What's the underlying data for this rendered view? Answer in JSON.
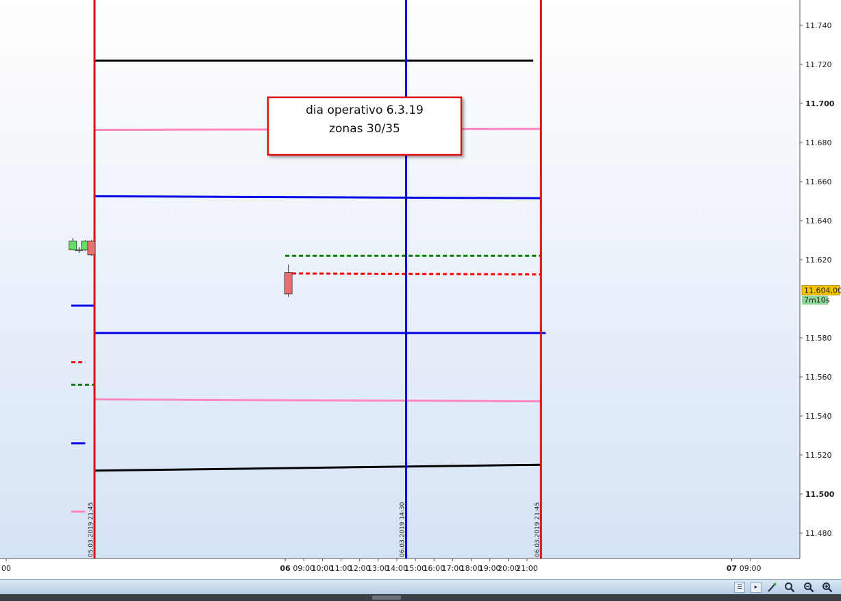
{
  "chart_data": {
    "type": "candlestick",
    "y_range": [
      11467,
      11753
    ],
    "y_ticks": [
      {
        "label": "11.740",
        "value": 11740,
        "bold": false
      },
      {
        "label": "11.720",
        "value": 11720,
        "bold": false
      },
      {
        "label": "11.700",
        "value": 11700,
        "bold": true
      },
      {
        "label": "11.680",
        "value": 11680,
        "bold": false
      },
      {
        "label": "11.660",
        "value": 11660,
        "bold": false
      },
      {
        "label": "11.640",
        "value": 11640,
        "bold": false
      },
      {
        "label": "11.620",
        "value": 11620,
        "bold": false
      },
      {
        "label": "11.580",
        "value": 11580,
        "bold": false
      },
      {
        "label": "11.560",
        "value": 11560,
        "bold": false
      },
      {
        "label": "11.540",
        "value": 11540,
        "bold": false
      },
      {
        "label": "11.520",
        "value": 11520,
        "bold": false
      },
      {
        "label": "11.500",
        "value": 11500,
        "bold": true
      },
      {
        "label": "11.480",
        "value": 11480,
        "bold": false
      }
    ],
    "x_range": [
      "05.03.2019 16:40",
      "07.03.2019 11:40"
    ],
    "x_ticks": [
      {
        "label": "00",
        "time": "05.03.2019 17:00",
        "bold": false
      },
      {
        "label": "06",
        "time": "06.03.2019 08:00",
        "bold": true
      },
      {
        "label": "09:00",
        "time": "06.03.2019 09:00",
        "bold": false
      },
      {
        "label": "10:00",
        "time": "06.03.2019 10:00",
        "bold": false
      },
      {
        "label": "11:00",
        "time": "06.03.2019 11:00",
        "bold": false
      },
      {
        "label": "12:00",
        "time": "06.03.2019 12:00",
        "bold": false
      },
      {
        "label": "13:00",
        "time": "06.03.2019 13:00",
        "bold": false
      },
      {
        "label": "14:00",
        "time": "06.03.2019 14:00",
        "bold": false
      },
      {
        "label": "15:00",
        "time": "06.03.2019 15:00",
        "bold": false
      },
      {
        "label": "16:00",
        "time": "06.03.2019 16:00",
        "bold": false
      },
      {
        "label": "17:00",
        "time": "06.03.2019 17:00",
        "bold": false
      },
      {
        "label": "18:00",
        "time": "06.03.2019 18:00",
        "bold": false
      },
      {
        "label": "19:00",
        "time": "06.03.2019 19:00",
        "bold": false
      },
      {
        "label": "20:00",
        "time": "06.03.2019 20:00",
        "bold": false
      },
      {
        "label": "21:00",
        "time": "06.03.2019 21:00",
        "bold": false
      },
      {
        "label": "07",
        "time": "07.03.2019 08:00",
        "bold": true
      },
      {
        "label": "09:00",
        "time": "07.03.2019 09:00",
        "bold": false
      }
    ],
    "vertical_lines": [
      {
        "label": "05.03.2019 21:45",
        "time": "05.03.2019 21:45",
        "color": "#e01010"
      },
      {
        "label": "06.03.2019 14:30",
        "time": "06.03.2019 14:30",
        "color": "#0000e6"
      },
      {
        "label": "06.03.2019 21:45",
        "time": "06.03.2019 21:45",
        "color": "#e01010"
      }
    ],
    "horizontal_lines": [
      {
        "color": "#000000",
        "style": "solid",
        "t1": "05.03.2019 21:45",
        "v1": 11722,
        "t2": "06.03.2019 21:20",
        "v2": 11722
      },
      {
        "color": "#ff88c0",
        "style": "solid",
        "t1": "05.03.2019 21:45",
        "v1": 11686.5,
        "t2": "06.03.2019 21:45",
        "v2": 11687
      },
      {
        "color": "#0000e6",
        "style": "solid",
        "t1": "05.03.2019 21:45",
        "v1": 11652.5,
        "t2": "06.03.2019 21:45",
        "v2": 11651.5
      },
      {
        "color": "#008000",
        "style": "dashed",
        "t1": "06.03.2019 08:00",
        "v1": 11622,
        "t2": "06.03.2019 21:45",
        "v2": 11622
      },
      {
        "color": "#ff0000",
        "style": "dashed",
        "t1": "06.03.2019 08:00",
        "v1": 11613,
        "t2": "06.03.2019 21:45",
        "v2": 11612.5
      },
      {
        "color": "#0000e6",
        "style": "solid",
        "t1": "05.03.2019 20:30",
        "v1": 11596.5,
        "t2": "05.03.2019 21:45",
        "v2": 11596.5
      },
      {
        "color": "#0000e6",
        "style": "solid",
        "t1": "05.03.2019 21:45",
        "v1": 11582.5,
        "t2": "06.03.2019 22:00",
        "v2": 11582.5
      },
      {
        "color": "#ff0000",
        "style": "dashed",
        "t1": "05.03.2019 20:30",
        "v1": 11567.5,
        "t2": "05.03.2019 21:15",
        "v2": 11567.5
      },
      {
        "color": "#008000",
        "style": "dashed",
        "t1": "05.03.2019 20:30",
        "v1": 11556,
        "t2": "05.03.2019 21:45",
        "v2": 11556
      },
      {
        "color": "#ff88c0",
        "style": "solid",
        "t1": "05.03.2019 21:45",
        "v1": 11548.5,
        "t2": "06.03.2019 21:45",
        "v2": 11547.5
      },
      {
        "color": "#0000e6",
        "style": "solid",
        "t1": "05.03.2019 20:30",
        "v1": 11526,
        "t2": "05.03.2019 21:15",
        "v2": 11526
      },
      {
        "color": "#000000",
        "style": "solid",
        "t1": "05.03.2019 21:45",
        "v1": 11512,
        "t2": "06.03.2019 21:45",
        "v2": 11515
      },
      {
        "color": "#ff88c0",
        "style": "solid",
        "t1": "05.03.2019 20:30",
        "v1": 11491,
        "t2": "05.03.2019 21:15",
        "v2": 11491
      }
    ],
    "candles": [
      {
        "time": "05.03.2019 20:35",
        "open": 11625,
        "high": 11631,
        "low": 11625,
        "close": 11629.5
      },
      {
        "time": "05.03.2019 20:55",
        "open": 11625,
        "high": 11626.5,
        "low": 11623.5,
        "close": 11625
      },
      {
        "time": "05.03.2019 21:15",
        "open": 11625,
        "high": 11630,
        "low": 11624.5,
        "close": 11629.5
      },
      {
        "time": "05.03.2019 21:35",
        "open": 11629.5,
        "high": 11630,
        "low": 11622,
        "close": 11622.5
      },
      {
        "time": "06.03.2019 08:10",
        "open": 11613.5,
        "high": 11617.5,
        "low": 11601,
        "close": 11602.5
      }
    ],
    "price_label": "11.604,00",
    "price_value": 11604,
    "timer_label": "7m10s",
    "annotations": [
      {
        "lines": [
          "dia operativo 6.3.19",
          "zonas 30/35"
        ]
      }
    ]
  },
  "colors": {
    "background_top": "#ffffff",
    "background_bottom": "#d6e3f5",
    "bear_candle": "#ec6f6f",
    "bull_candle": "#66dd66",
    "price_label_bg": "#f5c400",
    "timer_label_bg": "#8fd89a",
    "annotation_border": "#e01010"
  },
  "toolbar": {
    "icons": [
      "scroll-left-icon",
      "play-icon",
      "magic-wand-icon",
      "zoom-fit-icon",
      "zoom-out-icon",
      "zoom-in-icon"
    ],
    "play_glyph": "▸",
    "zoom_out_glyph": "🔍︎−",
    "zoom_in_glyph": "🔍︎+"
  }
}
